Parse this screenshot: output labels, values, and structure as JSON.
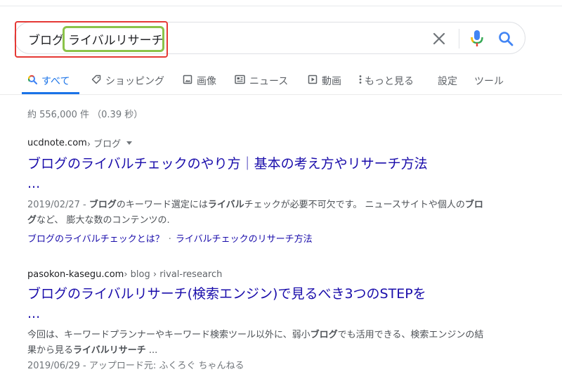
{
  "search": {
    "query_part1": "ブログ",
    "query_part2": "ライバルリサーチ"
  },
  "tabs": [
    {
      "label": "すべて",
      "icon": "search-icon",
      "active": true
    },
    {
      "label": "ショッピング",
      "icon": "tag-icon"
    },
    {
      "label": "画像",
      "icon": "image-icon"
    },
    {
      "label": "ニュース",
      "icon": "news-icon"
    },
    {
      "label": "動画",
      "icon": "video-icon"
    },
    {
      "label": "もっと見る",
      "icon": "more-vert-icon"
    },
    {
      "label": "設定"
    },
    {
      "label": "ツール"
    }
  ],
  "stats": "約 556,000 件 （0.39 秒）",
  "results": [
    {
      "site": "ucdnote.com",
      "path": " › ブログ",
      "title_line1": "ブログのライバルチェックのやり方｜基本の考え方やリサーチ方法",
      "title_line2": "...",
      "date": "2019/02/27 - ",
      "snippet_parts": [
        "ブログ",
        "のキーワード選定には",
        "ライバル",
        "チェックが必要不可欠です。 ニュースサイトや個人の",
        "ブログ",
        "など、 膨大な数のコンテンツの."
      ],
      "sitelinks": [
        "ブログのライバルチェックとは？",
        "ライバルチェックのリサーチ方法"
      ]
    },
    {
      "site": "pasokon-kasegu.com",
      "path": " › blog › rival-research",
      "title_line1": "ブログのライバルリサーチ(検索エンジン)で見るべき3つのSTEPを",
      "title_line2": "...",
      "snippet_parts": [
        "今回は、キーワードプランナーやキーワード検索ツール以外に、弱小",
        "ブログ",
        "でも活用できる、検索エンジンの結果から見る",
        "ライバルリサーチ",
        " ..."
      ],
      "date_line": "2019/06/29 - アップロード元: ふくろぐ ちゃんねる"
    }
  ],
  "colors": {
    "link": "#1a0dab",
    "accent_blue": "#1a73e8",
    "highlight_red": "#e53935",
    "highlight_green": "#8bc34a"
  }
}
